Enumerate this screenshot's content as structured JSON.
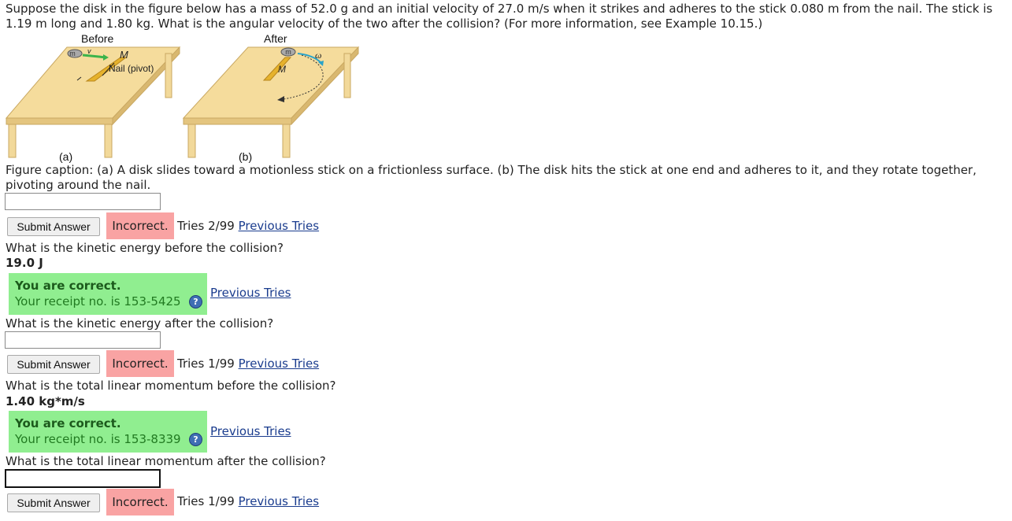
{
  "problem": {
    "line1": "Suppose the disk in the figure below has a mass of 52.0 g and an initial velocity of 27.0 m/s when it strikes and adheres to the stick 0.080 m from the nail. The stick is",
    "line2": "1.19 m long and 1.80 kg. What is the angular velocity of the two after the collision? (For more information, see Example 10.15.)"
  },
  "figure": {
    "before_label": "Before",
    "after_label": "After",
    "panel_a": "(a)",
    "panel_b": "(b)",
    "m_label": "m",
    "v_label": "v",
    "M_label": "M",
    "nail_label": "Nail (pivot)",
    "omega_label": "ω",
    "caption_line1": "Figure caption: (a) A disk slides toward a motionless stick on a frictionless surface. (b) The disk hits the stick at one end and adheres to it, and they rotate together,",
    "caption_line2": "pivoting around the nail."
  },
  "common": {
    "submit_label": "Submit Answer",
    "incorrect_label": "Incorrect.",
    "previous_tries_label": "Previous Tries",
    "correct_label": "You are correct.",
    "help_glyph": "?"
  },
  "q1": {
    "tries": "Tries 2/99",
    "value": ""
  },
  "q2": {
    "question": "What is the kinetic energy before the collision?",
    "answer": "19.0 J",
    "receipt": "Your receipt no. is 153-5425"
  },
  "q3": {
    "question": "What is the kinetic energy after the collision?",
    "tries": "Tries 1/99",
    "value": ""
  },
  "q4": {
    "question": "What is the total linear momentum before the collision?",
    "answer": "1.40 kg*m/s",
    "receipt": "Your receipt no. is 153-8339"
  },
  "q5": {
    "question": "What is the total linear momentum after the collision?",
    "tries": "Tries 1/99",
    "value": ""
  },
  "colors": {
    "incorrect_bg": "#f9a3a3",
    "correct_bg": "#90ee90",
    "link": "#1a3c8e",
    "table_top": "#f5dc9c",
    "stick": "#e6b22c"
  }
}
